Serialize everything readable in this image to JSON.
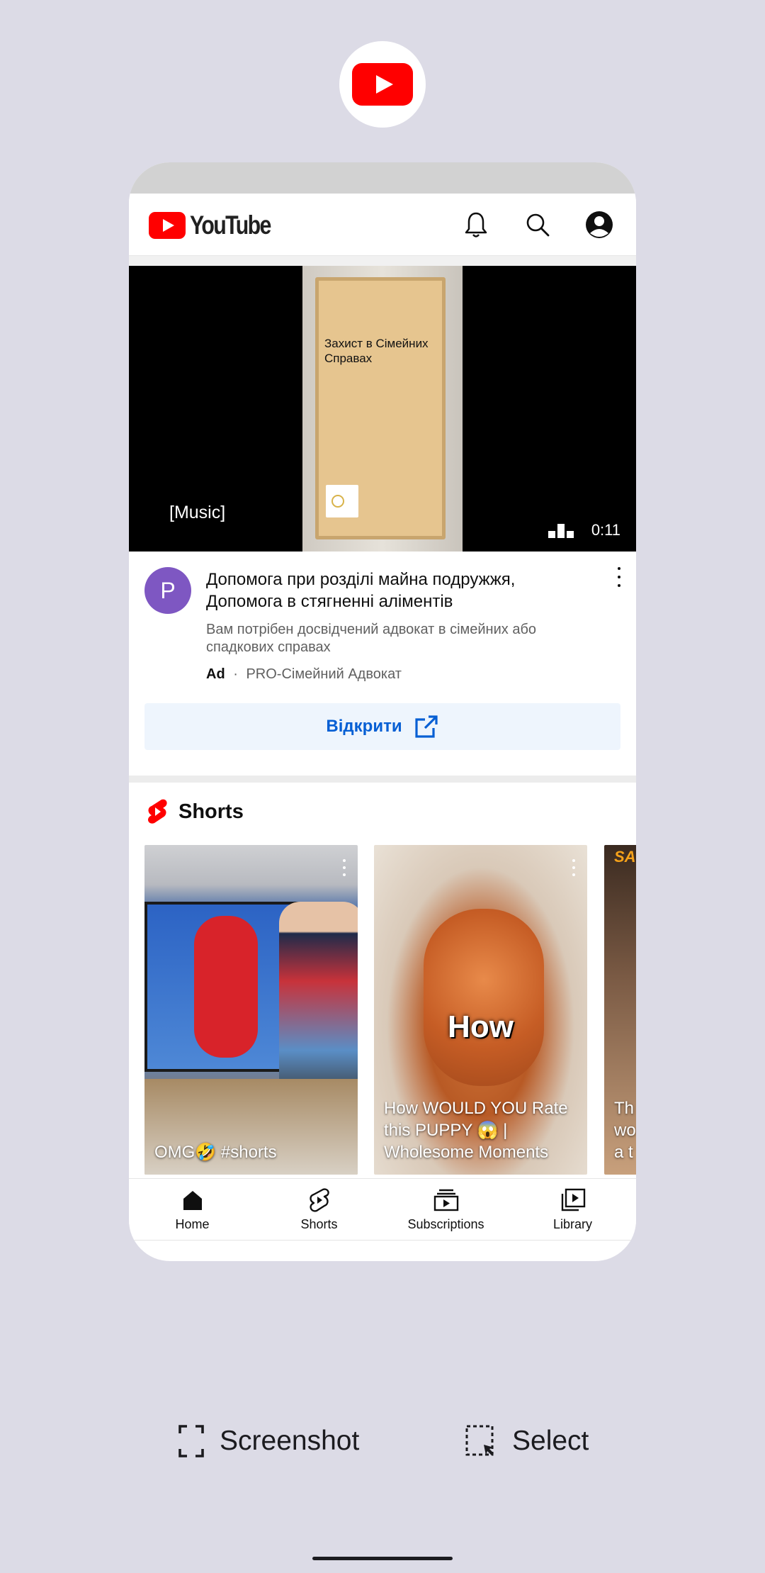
{
  "app": {
    "name": "YouTube",
    "icon": "youtube-app-icon",
    "brand_color": "#ff0000"
  },
  "header": {
    "logo_text": "YouTube",
    "icons": [
      "bell-icon",
      "search-icon",
      "account-icon"
    ]
  },
  "ad": {
    "video_caption": "[Music]",
    "duration": "0:11",
    "door_text": "Захист в Сімейних Справах",
    "avatar_letter": "P",
    "avatar_color": "#7e57c2",
    "title": "Допомога при розділі майна подружжя, Допомога в стягненні аліментів",
    "description": "Вам потрібен досвідчений адвокат в сімейних або спадкових справах",
    "badge": "Ad",
    "dot": "·",
    "advertiser": "PRO-Сімейний Адвокат",
    "cta_label": "Відкрити",
    "cta_color": "#065fd4"
  },
  "shorts": {
    "title": "Shorts",
    "items": [
      {
        "title": "OMG🤣 #shorts"
      },
      {
        "overlay": "How",
        "title": "How WOULD YOU Rate this PUPPY 😱 | Wholesome Moments"
      },
      {
        "badge": "SA",
        "title": "Th\nwo\na t"
      }
    ]
  },
  "bottom_nav": [
    {
      "label": "Home",
      "icon": "home-icon"
    },
    {
      "label": "Shorts",
      "icon": "shorts-icon"
    },
    {
      "label": "Subscriptions",
      "icon": "subscriptions-icon"
    },
    {
      "label": "Library",
      "icon": "library-icon"
    }
  ],
  "actions": {
    "screenshot_label": "Screenshot",
    "select_label": "Select"
  }
}
